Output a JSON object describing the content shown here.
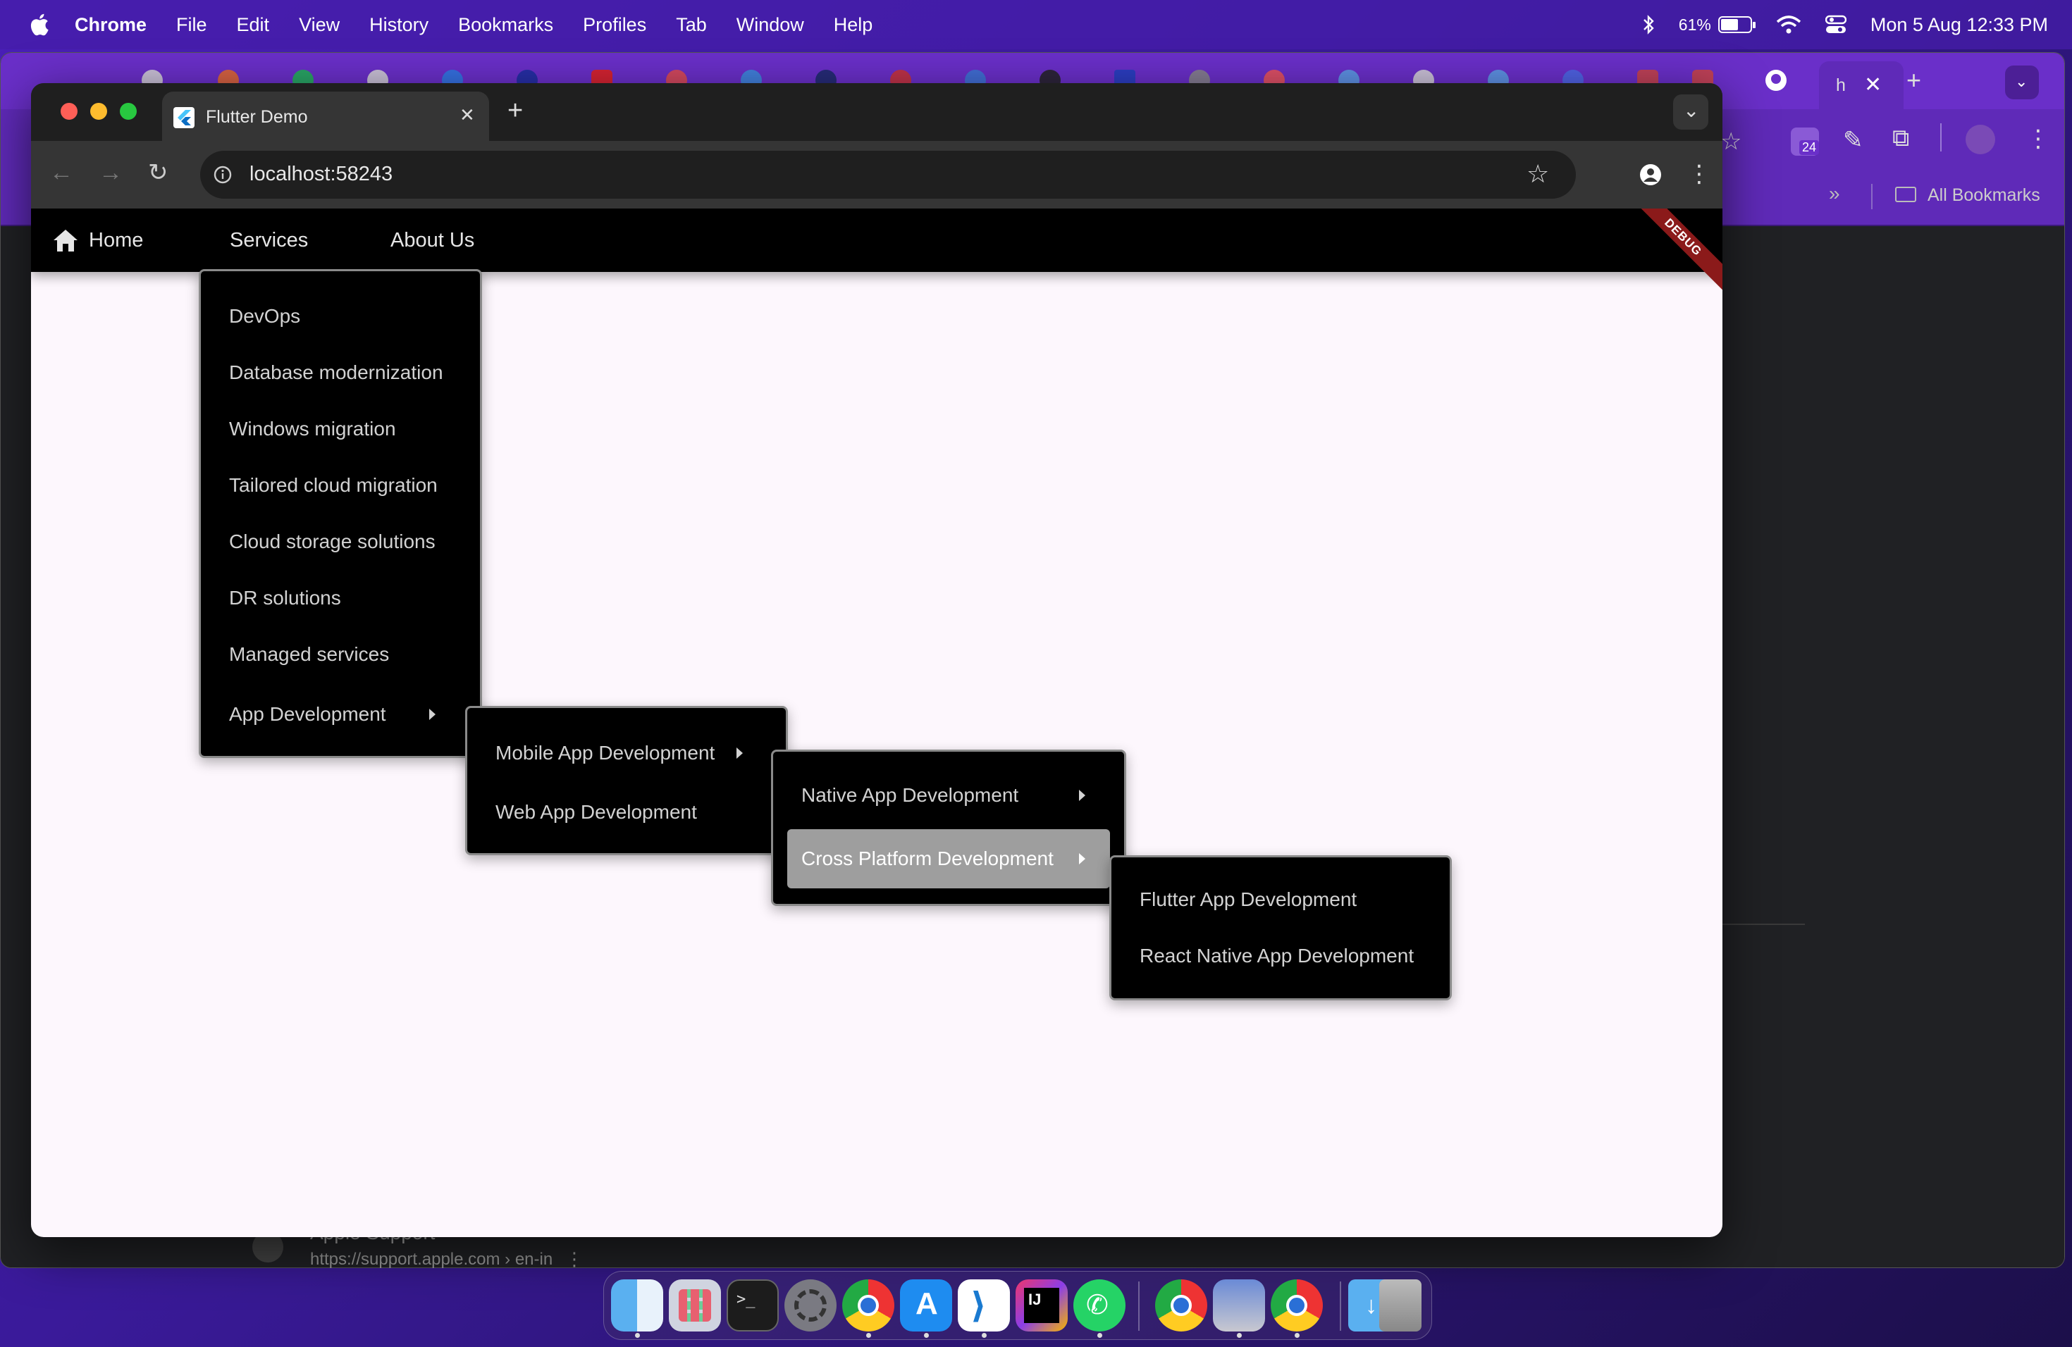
{
  "menubar": {
    "app": "Chrome",
    "items": [
      "File",
      "Edit",
      "View",
      "History",
      "Bookmarks",
      "Profiles",
      "Tab",
      "Window",
      "Help"
    ],
    "battery": "61%",
    "datetime": "Mon 5 Aug  12:33 PM"
  },
  "background_window": {
    "bookmarks_label": "All Bookmarks",
    "badge": "24",
    "peek_title": "Apple Support",
    "peek_url": "https://support.apple.com › en-in"
  },
  "browser": {
    "tab_title": "Flutter Demo",
    "url": "localhost:58243"
  },
  "app": {
    "nav": {
      "home": "Home",
      "services": "Services",
      "about": "About Us"
    },
    "debug_banner": "DEBUG",
    "services_menu": [
      "DevOps",
      "Database modernization",
      "Windows migration",
      "Tailored cloud migration",
      "Cloud storage solutions",
      "DR solutions",
      "Managed services",
      "App Development"
    ],
    "app_dev_menu": [
      "Mobile App Development",
      "Web App Development"
    ],
    "mobile_menu": [
      "Native App Development",
      "Cross Platform Development"
    ],
    "cross_platform_menu": [
      "Flutter App Development",
      "React Native App Development"
    ]
  },
  "colors": {
    "menu_bg": "#000000",
    "menu_text": "#d2d2d2",
    "active_item": "#9e9e9e",
    "app_bg": "#fdf7fd",
    "debug": "#8b1a1a"
  }
}
